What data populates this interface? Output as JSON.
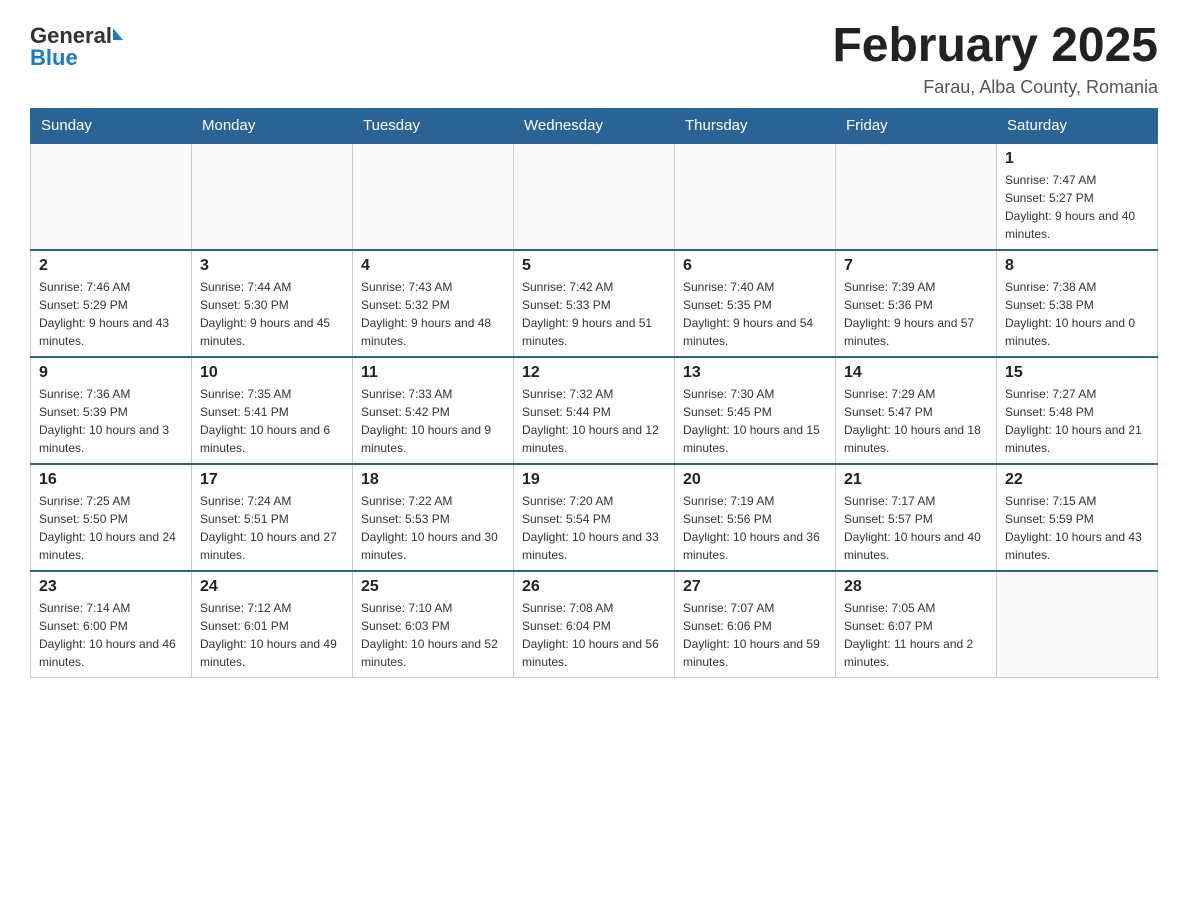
{
  "logo": {
    "general": "General",
    "arrow": "",
    "blue": "Blue"
  },
  "header": {
    "title": "February 2025",
    "location": "Farau, Alba County, Romania"
  },
  "weekdays": [
    "Sunday",
    "Monday",
    "Tuesday",
    "Wednesday",
    "Thursday",
    "Friday",
    "Saturday"
  ],
  "weeks": [
    {
      "days": [
        {
          "number": "",
          "info": ""
        },
        {
          "number": "",
          "info": ""
        },
        {
          "number": "",
          "info": ""
        },
        {
          "number": "",
          "info": ""
        },
        {
          "number": "",
          "info": ""
        },
        {
          "number": "",
          "info": ""
        },
        {
          "number": "1",
          "info": "Sunrise: 7:47 AM\nSunset: 5:27 PM\nDaylight: 9 hours and 40 minutes."
        }
      ]
    },
    {
      "days": [
        {
          "number": "2",
          "info": "Sunrise: 7:46 AM\nSunset: 5:29 PM\nDaylight: 9 hours and 43 minutes."
        },
        {
          "number": "3",
          "info": "Sunrise: 7:44 AM\nSunset: 5:30 PM\nDaylight: 9 hours and 45 minutes."
        },
        {
          "number": "4",
          "info": "Sunrise: 7:43 AM\nSunset: 5:32 PM\nDaylight: 9 hours and 48 minutes."
        },
        {
          "number": "5",
          "info": "Sunrise: 7:42 AM\nSunset: 5:33 PM\nDaylight: 9 hours and 51 minutes."
        },
        {
          "number": "6",
          "info": "Sunrise: 7:40 AM\nSunset: 5:35 PM\nDaylight: 9 hours and 54 minutes."
        },
        {
          "number": "7",
          "info": "Sunrise: 7:39 AM\nSunset: 5:36 PM\nDaylight: 9 hours and 57 minutes."
        },
        {
          "number": "8",
          "info": "Sunrise: 7:38 AM\nSunset: 5:38 PM\nDaylight: 10 hours and 0 minutes."
        }
      ]
    },
    {
      "days": [
        {
          "number": "9",
          "info": "Sunrise: 7:36 AM\nSunset: 5:39 PM\nDaylight: 10 hours and 3 minutes."
        },
        {
          "number": "10",
          "info": "Sunrise: 7:35 AM\nSunset: 5:41 PM\nDaylight: 10 hours and 6 minutes."
        },
        {
          "number": "11",
          "info": "Sunrise: 7:33 AM\nSunset: 5:42 PM\nDaylight: 10 hours and 9 minutes."
        },
        {
          "number": "12",
          "info": "Sunrise: 7:32 AM\nSunset: 5:44 PM\nDaylight: 10 hours and 12 minutes."
        },
        {
          "number": "13",
          "info": "Sunrise: 7:30 AM\nSunset: 5:45 PM\nDaylight: 10 hours and 15 minutes."
        },
        {
          "number": "14",
          "info": "Sunrise: 7:29 AM\nSunset: 5:47 PM\nDaylight: 10 hours and 18 minutes."
        },
        {
          "number": "15",
          "info": "Sunrise: 7:27 AM\nSunset: 5:48 PM\nDaylight: 10 hours and 21 minutes."
        }
      ]
    },
    {
      "days": [
        {
          "number": "16",
          "info": "Sunrise: 7:25 AM\nSunset: 5:50 PM\nDaylight: 10 hours and 24 minutes."
        },
        {
          "number": "17",
          "info": "Sunrise: 7:24 AM\nSunset: 5:51 PM\nDaylight: 10 hours and 27 minutes."
        },
        {
          "number": "18",
          "info": "Sunrise: 7:22 AM\nSunset: 5:53 PM\nDaylight: 10 hours and 30 minutes."
        },
        {
          "number": "19",
          "info": "Sunrise: 7:20 AM\nSunset: 5:54 PM\nDaylight: 10 hours and 33 minutes."
        },
        {
          "number": "20",
          "info": "Sunrise: 7:19 AM\nSunset: 5:56 PM\nDaylight: 10 hours and 36 minutes."
        },
        {
          "number": "21",
          "info": "Sunrise: 7:17 AM\nSunset: 5:57 PM\nDaylight: 10 hours and 40 minutes."
        },
        {
          "number": "22",
          "info": "Sunrise: 7:15 AM\nSunset: 5:59 PM\nDaylight: 10 hours and 43 minutes."
        }
      ]
    },
    {
      "days": [
        {
          "number": "23",
          "info": "Sunrise: 7:14 AM\nSunset: 6:00 PM\nDaylight: 10 hours and 46 minutes."
        },
        {
          "number": "24",
          "info": "Sunrise: 7:12 AM\nSunset: 6:01 PM\nDaylight: 10 hours and 49 minutes."
        },
        {
          "number": "25",
          "info": "Sunrise: 7:10 AM\nSunset: 6:03 PM\nDaylight: 10 hours and 52 minutes."
        },
        {
          "number": "26",
          "info": "Sunrise: 7:08 AM\nSunset: 6:04 PM\nDaylight: 10 hours and 56 minutes."
        },
        {
          "number": "27",
          "info": "Sunrise: 7:07 AM\nSunset: 6:06 PM\nDaylight: 10 hours and 59 minutes."
        },
        {
          "number": "28",
          "info": "Sunrise: 7:05 AM\nSunset: 6:07 PM\nDaylight: 11 hours and 2 minutes."
        },
        {
          "number": "",
          "info": ""
        }
      ]
    }
  ]
}
